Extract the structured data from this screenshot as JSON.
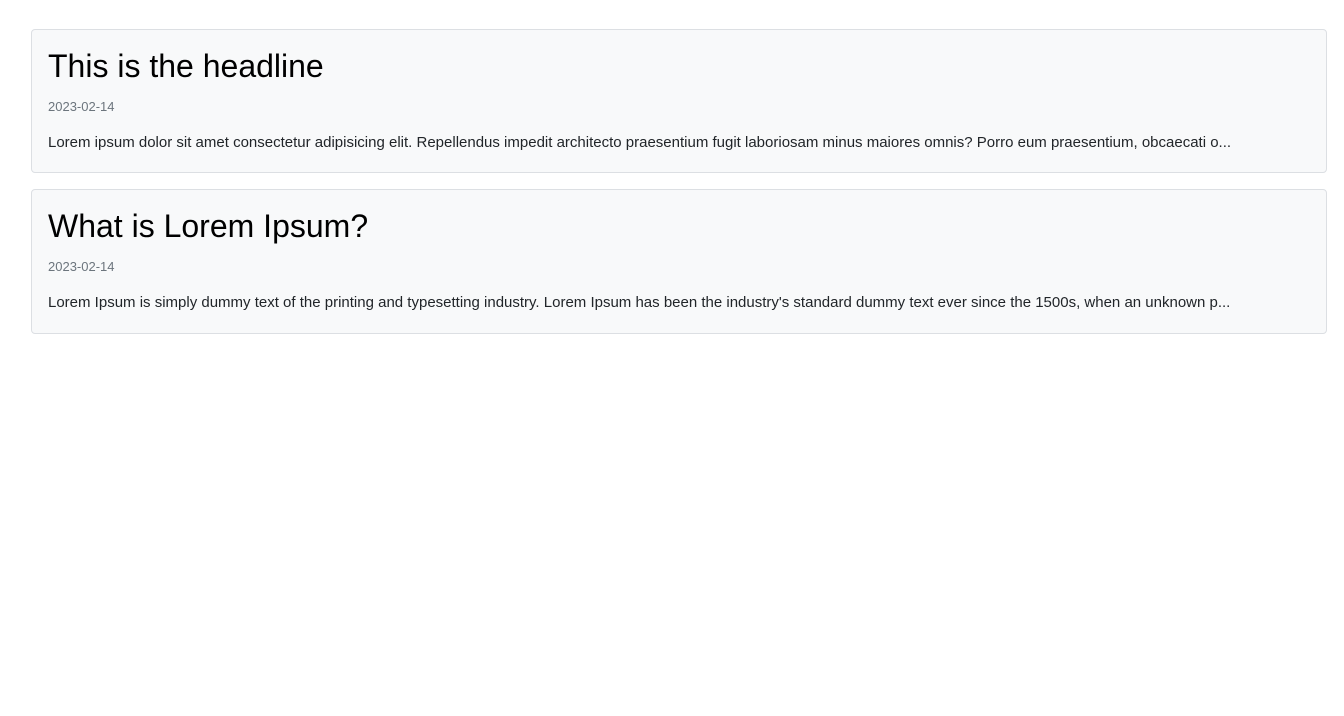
{
  "posts": [
    {
      "title": "This is the headline",
      "date": "2023-02-14",
      "excerpt": "Lorem ipsum dolor sit amet consectetur adipisicing elit. Repellendus impedit architecto praesentium fugit laboriosam minus maiores omnis? Porro eum praesentium, obcaecati o..."
    },
    {
      "title": "What is Lorem Ipsum?",
      "date": "2023-02-14",
      "excerpt": "Lorem Ipsum is simply dummy text of the printing and typesetting industry. Lorem Ipsum has been the industry's standard dummy text ever since the 1500s, when an unknown p..."
    }
  ]
}
